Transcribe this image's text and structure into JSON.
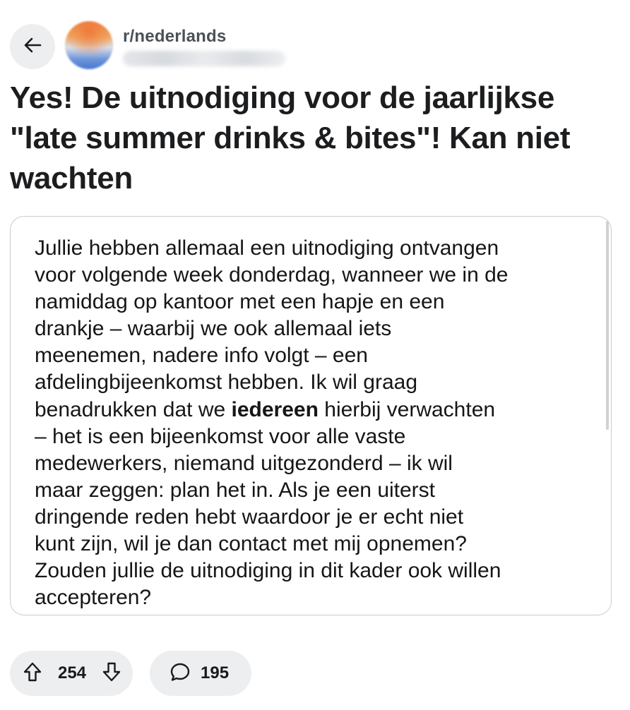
{
  "header": {
    "back_icon": "arrow-left-icon",
    "subreddit": "r/nederlands"
  },
  "post": {
    "title": "Yes! De uitnodiging voor de jaarlijkse \"late summer drinks & bites\"! Kan niet wachten",
    "image_text": {
      "before_bold": "Jullie hebben allemaal een uitnodiging ontvangen\nvoor volgende week donderdag, wanneer we in de\nnamiddag op kantoor met een hapje en een\ndrankje – waarbij we ook allemaal iets\nmeenemen, nadere info volgt  – een\nafdelingbijeenkomst hebben. Ik wil graag\nbenadrukken dat we ",
      "bold": "iedereen",
      "after_bold": " hierbij verwachten\n– het is een bijeenkomst voor alle vaste\nmedewerkers, niemand uitgezonderd – ik wil\nmaar zeggen: plan het in. Als je een uiterst\ndringende reden hebt waardoor je er echt niet\nkunt zijn, wil je dan contact met mij opnemen?\nZouden jullie de uitnodiging in dit kader ook willen\naccepteren?"
    }
  },
  "actions": {
    "upvote_icon": "upvote-arrow-icon",
    "downvote_icon": "downvote-arrow-icon",
    "comment_icon": "comment-bubble-icon",
    "vote_count": "254",
    "comment_count": "195"
  },
  "colors": {
    "pill_background": "#eceef0",
    "text_primary": "#1a1a1b",
    "subreddit_text": "#4a5157"
  }
}
